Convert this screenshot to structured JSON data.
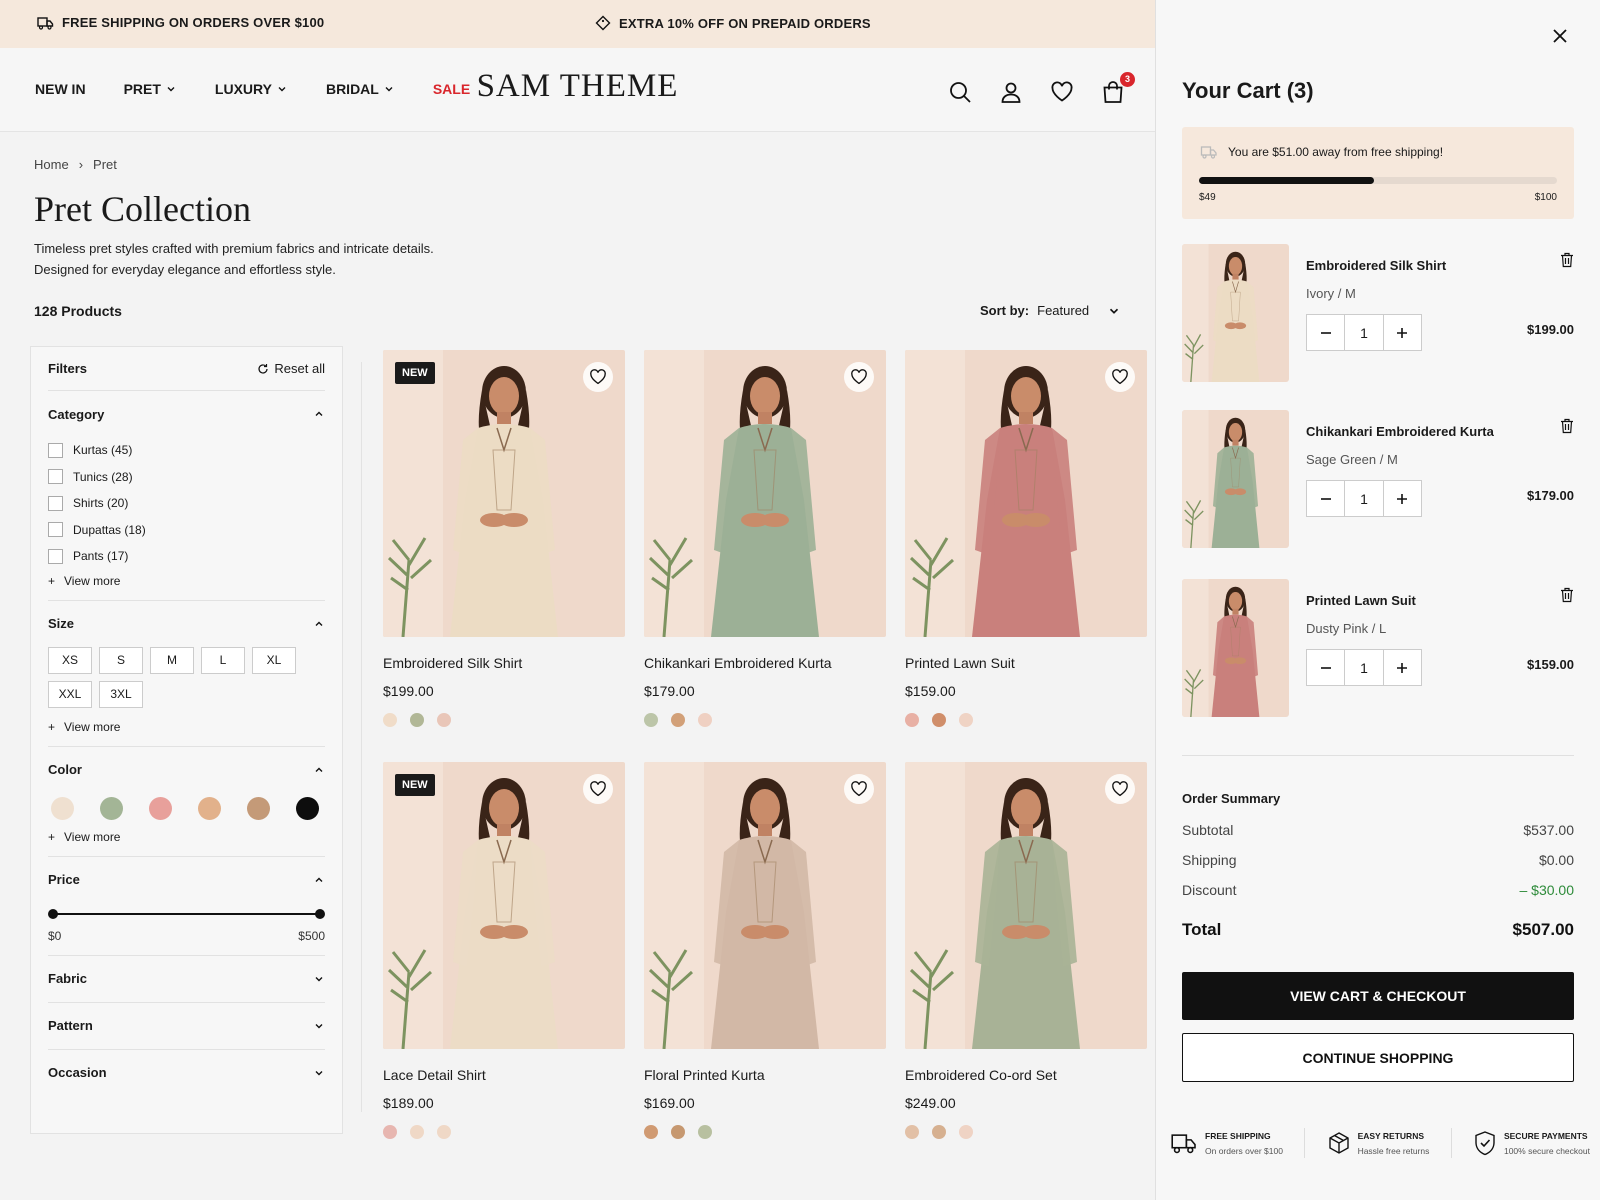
{
  "promo": {
    "shipping": "FREE SHIPPING ON ORDERS OVER $100",
    "prepaid": "EXTRA 10% OFF ON PREPAID ORDERS"
  },
  "nav": {
    "items": [
      "NEW IN",
      "PRET",
      "LUXURY",
      "BRIDAL",
      "SALE"
    ],
    "logo": "SAM THEME",
    "cart_count": "3"
  },
  "breadcrumb": {
    "home": "Home",
    "sep": "›",
    "current": "Pret"
  },
  "page": {
    "title": "Pret Collection",
    "desc1": "Timeless pret styles crafted with premium fabrics and intricate details.",
    "desc2": "Designed for everyday elegance and effortless style.",
    "count": "128 Products",
    "sort_label": "Sort by:",
    "sort_value": "Featured"
  },
  "filters": {
    "title": "Filters",
    "reset": "Reset all",
    "category_title": "Category",
    "categories": [
      "Kurtas (45)",
      "Tunics (28)",
      "Shirts (20)",
      "Dupattas (18)",
      "Pants (17)"
    ],
    "view_more": "View more",
    "size_title": "Size",
    "sizes": [
      "XS",
      "S",
      "M",
      "L",
      "XL",
      "XXL",
      "3XL"
    ],
    "color_title": "Color",
    "colors": [
      "#efe0d0",
      "#a3b596",
      "#e8a09b",
      "#e2b18b",
      "#c49a78",
      "#0d0d0d"
    ],
    "price_title": "Price",
    "price_min": "$0",
    "price_max": "$500",
    "fabric_title": "Fabric",
    "pattern_title": "Pattern",
    "occasion_title": "Occasion"
  },
  "products": [
    {
      "name": "Embroidered Silk Shirt",
      "price": "$199.00",
      "badge": "NEW",
      "dress": "#ecdcc4",
      "swatches": [
        "#f0dcc8",
        "#b1b796",
        "#e9c6b8"
      ]
    },
    {
      "name": "Chikankari Embroidered Kurta",
      "price": "$179.00",
      "badge": "",
      "dress": "#9cb096",
      "swatches": [
        "#bcc5a8",
        "#d2a078",
        "#efd0c2"
      ]
    },
    {
      "name": "Printed Lawn Suit",
      "price": "$159.00",
      "badge": "",
      "dress": "#c9807c",
      "swatches": [
        "#e8b0a4",
        "#d08e6a",
        "#efd3c4"
      ]
    },
    {
      "name": "Lace Detail Shirt",
      "price": "$189.00",
      "badge": "NEW",
      "dress": "#ecdcc6",
      "swatches": [
        "#e7b6b0",
        "#efd8c6",
        "#efd8c6"
      ]
    },
    {
      "name": "Floral Printed Kurta",
      "price": "$169.00",
      "badge": "",
      "dress": "#d2b8a6",
      "swatches": [
        "#d09a72",
        "#c69870",
        "#b8c0a0"
      ]
    },
    {
      "name": "Embroidered Co-ord Set",
      "price": "$249.00",
      "badge": "",
      "dress": "#a8b296",
      "swatches": [
        "#e2c0a6",
        "#d6b090",
        "#efd3c4"
      ]
    }
  ],
  "cart": {
    "title": "Your Cart (3)",
    "ship_msg": "You are $51.00 away from free shipping!",
    "ship_progress": 0.49,
    "ship_min": "$49",
    "ship_max": "$100",
    "items": [
      {
        "name": "Embroidered Silk Shirt",
        "variant": "Ivory / M",
        "qty": "1",
        "price": "$199.00",
        "dress": "#ecdcc4"
      },
      {
        "name": "Chikankari Embroidered Kurta",
        "variant": "Sage Green / M",
        "qty": "1",
        "price": "$179.00",
        "dress": "#9cb096"
      },
      {
        "name": "Printed Lawn Suit",
        "variant": "Dusty Pink / L",
        "qty": "1",
        "price": "$159.00",
        "dress": "#c9807c"
      }
    ],
    "summary_title": "Order Summary",
    "subtotal_label": "Subtotal",
    "subtotal": "$537.00",
    "shipping_label": "Shipping",
    "shipping": "$0.00",
    "discount_label": "Discount",
    "discount": "– $30.00",
    "total_label": "Total",
    "total": "$507.00",
    "checkout": "VIEW CART & CHECKOUT",
    "continue": "CONTINUE SHOPPING"
  },
  "trust": [
    {
      "title": "FREE SHIPPING",
      "sub": "On orders over $100"
    },
    {
      "title": "EASY RETURNS",
      "sub": "Hassle free returns"
    },
    {
      "title": "SECURE PAYMENTS",
      "sub": "100% secure checkout"
    }
  ]
}
